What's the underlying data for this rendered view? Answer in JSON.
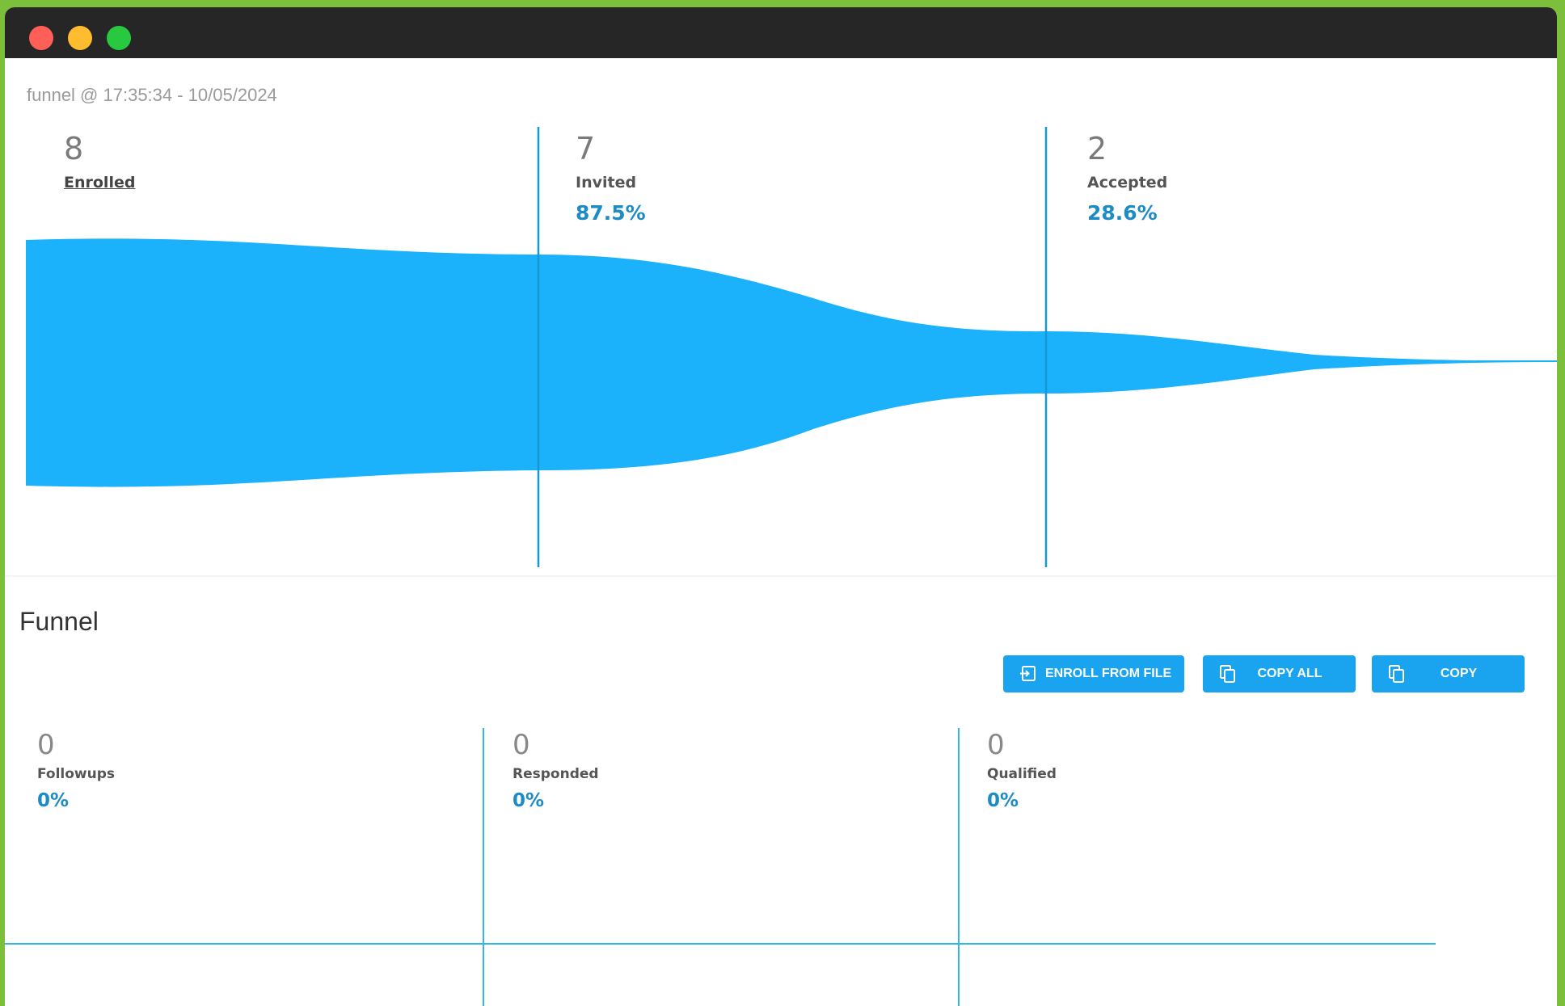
{
  "window": {
    "subtitle": "funnel @ 17:35:34 - 10/05/2024"
  },
  "colors": {
    "funnel_fill": "#1cb1fb",
    "accent": "#1d8cc6",
    "button": "#1aa3ee"
  },
  "top_funnel": {
    "stages": [
      {
        "count": "8",
        "label": "Enrolled",
        "pct": ""
      },
      {
        "count": "7",
        "label": "Invited",
        "pct": "87.5%"
      },
      {
        "count": "2",
        "label": "Accepted",
        "pct": "28.6%"
      }
    ]
  },
  "section": {
    "title": "Funnel"
  },
  "toolbar": {
    "enroll_label": "ENROLL FROM FILE",
    "copy_all_label": "COPY ALL",
    "copy_label": "COPY"
  },
  "bottom_funnel": {
    "stages": [
      {
        "count": "0",
        "label": "Followups",
        "pct": "0%"
      },
      {
        "count": "0",
        "label": "Responded",
        "pct": "0%"
      },
      {
        "count": "0",
        "label": "Qualified",
        "pct": "0%"
      }
    ]
  }
}
